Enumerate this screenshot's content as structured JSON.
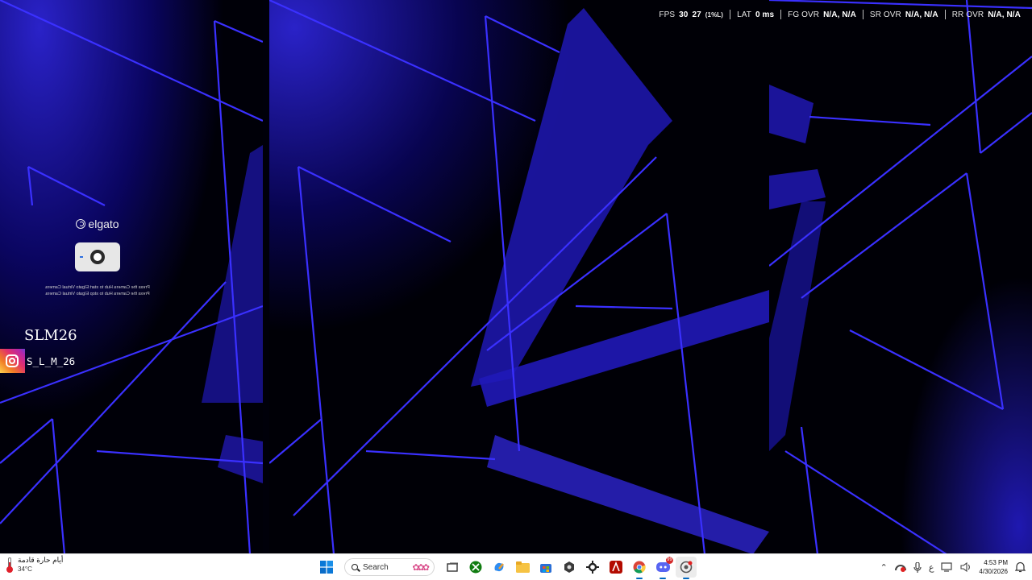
{
  "overlay": {
    "fps_label": "FPS",
    "fps_value": "30",
    "fps_low_value": "27",
    "fps_low_label": "(1%L)",
    "lat_label": "LAT",
    "lat_value": "0 ms",
    "fg_label": "FG OVR",
    "fg_value": "N/A, N/A",
    "sr_label": "SR OVR",
    "sr_value": "N/A, N/A",
    "rr_label": "RR OVR",
    "rr_value": "N/A, N/A"
  },
  "elgato": {
    "brand": "elgato",
    "message_line1": "Press the Camera Hub to start Elgato Virtual Camera",
    "message_line2": "Press the Camera Hub to stop Elgato Virtual Camera"
  },
  "channel": {
    "name": "SLM26",
    "instagram_handle": "S_L_M_26"
  },
  "taskbar": {
    "weather_text": "أيام حارة قادمة",
    "weather_temp": "34°C",
    "search_label": "Search",
    "discord_badge": "99",
    "lang_indicator": "ع",
    "time": "4:53 PM",
    "date": "4/30/2026"
  },
  "icons": {
    "start": "windows-start-icon",
    "search": "search-icon",
    "task_view": "task-view-icon",
    "xbox": "xbox-icon",
    "copilot": "copilot-icon",
    "files": "file-explorer-icon",
    "store": "store-icon",
    "obs": "obs-icon",
    "steelseries": "steelseries-icon",
    "acrobat": "acrobat-icon",
    "chrome": "chrome-icon",
    "discord": "discord-icon",
    "capture": "capture-app-icon"
  },
  "colors": {
    "neon_blue": "#2b2bff",
    "deep_blue": "#1a12b8",
    "taskbar_bg": "#ffffff"
  }
}
